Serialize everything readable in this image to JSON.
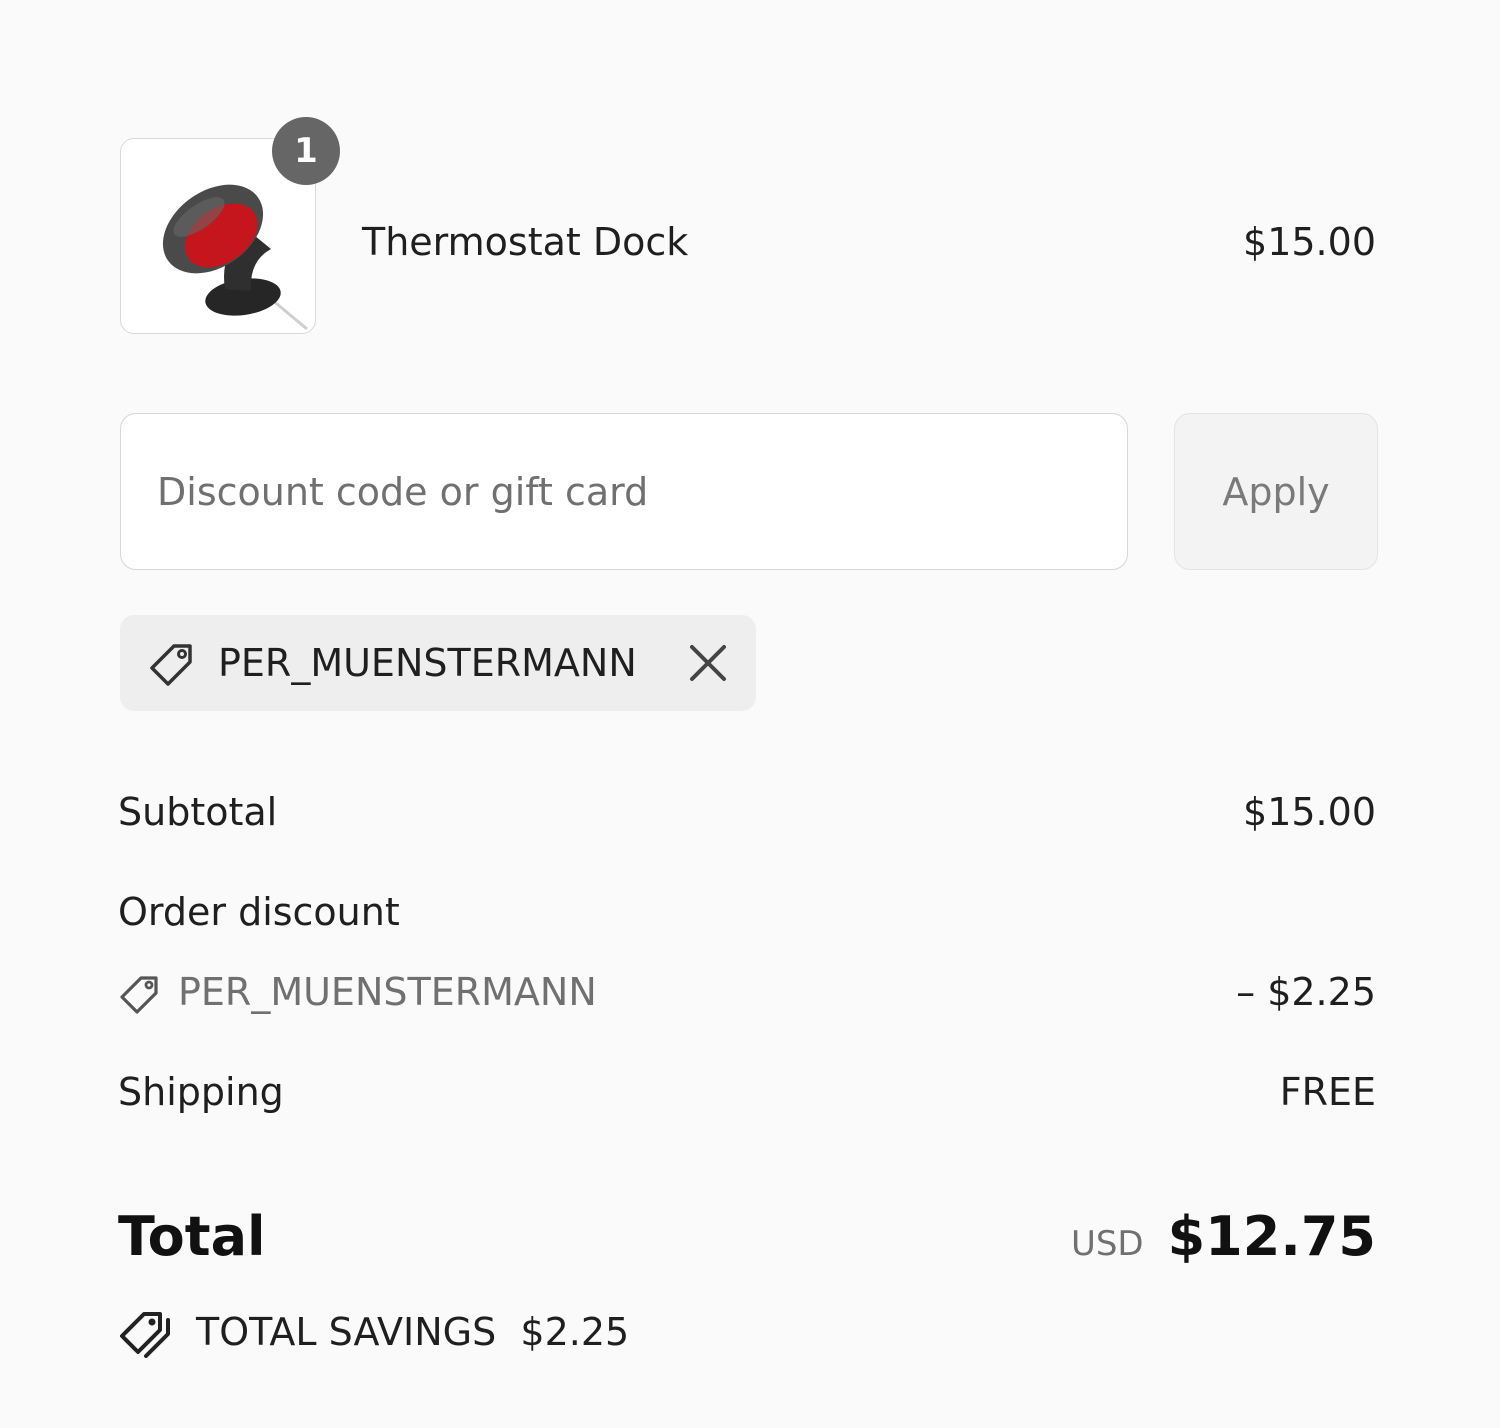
{
  "line_item": {
    "quantity": "1",
    "name": "Thermostat Dock",
    "price": "$15.00",
    "image_icon": "thermostat-dock-image"
  },
  "discount": {
    "placeholder": "Discount code or gift card",
    "value": "",
    "apply_label": "Apply",
    "applied_code": "PER_MUENSTERMANN",
    "remove_icon": "close-icon",
    "tag_icon": "tag-icon"
  },
  "summary": {
    "subtotal_label": "Subtotal",
    "subtotal_value": "$15.00",
    "order_discount_label": "Order discount",
    "order_discount_code": "PER_MUENSTERMANN",
    "order_discount_value": "– $2.25",
    "shipping_label": "Shipping",
    "shipping_value": "FREE",
    "total_label": "Total",
    "currency": "USD",
    "total_value": "$12.75",
    "savings_label": "TOTAL SAVINGS",
    "savings_value": "$2.25",
    "savings_icon": "tags-icon"
  }
}
